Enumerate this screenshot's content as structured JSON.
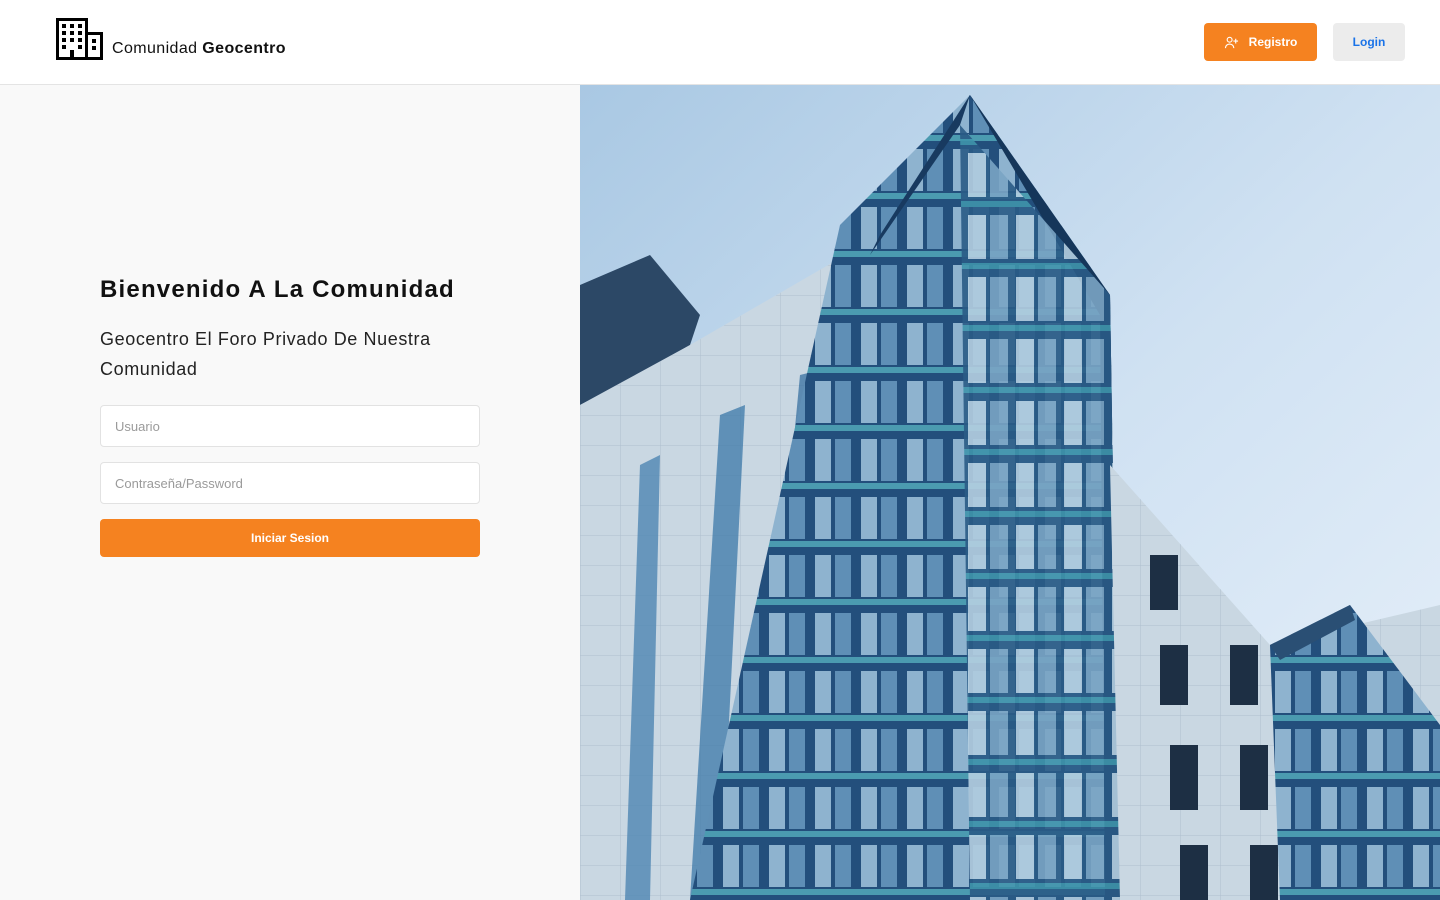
{
  "header": {
    "brand_prefix": "Comunidad",
    "brand_name": "Geocentro",
    "brand_icon": "building-icon",
    "register_label": "Registro",
    "register_icon": "user-plus-icon",
    "login_label": "Login"
  },
  "login": {
    "title": "Bienvenido A La Comunidad",
    "subtitle": "Geocentro El Foro Privado De Nuestra Comunidad",
    "username_placeholder": "Usuario",
    "password_placeholder": "Contraseña/Password",
    "submit_label": "Iniciar Sesion"
  },
  "colors": {
    "accent": "#f58220",
    "login_text": "#1a73e8",
    "panel_bg": "#f9f9f9"
  }
}
